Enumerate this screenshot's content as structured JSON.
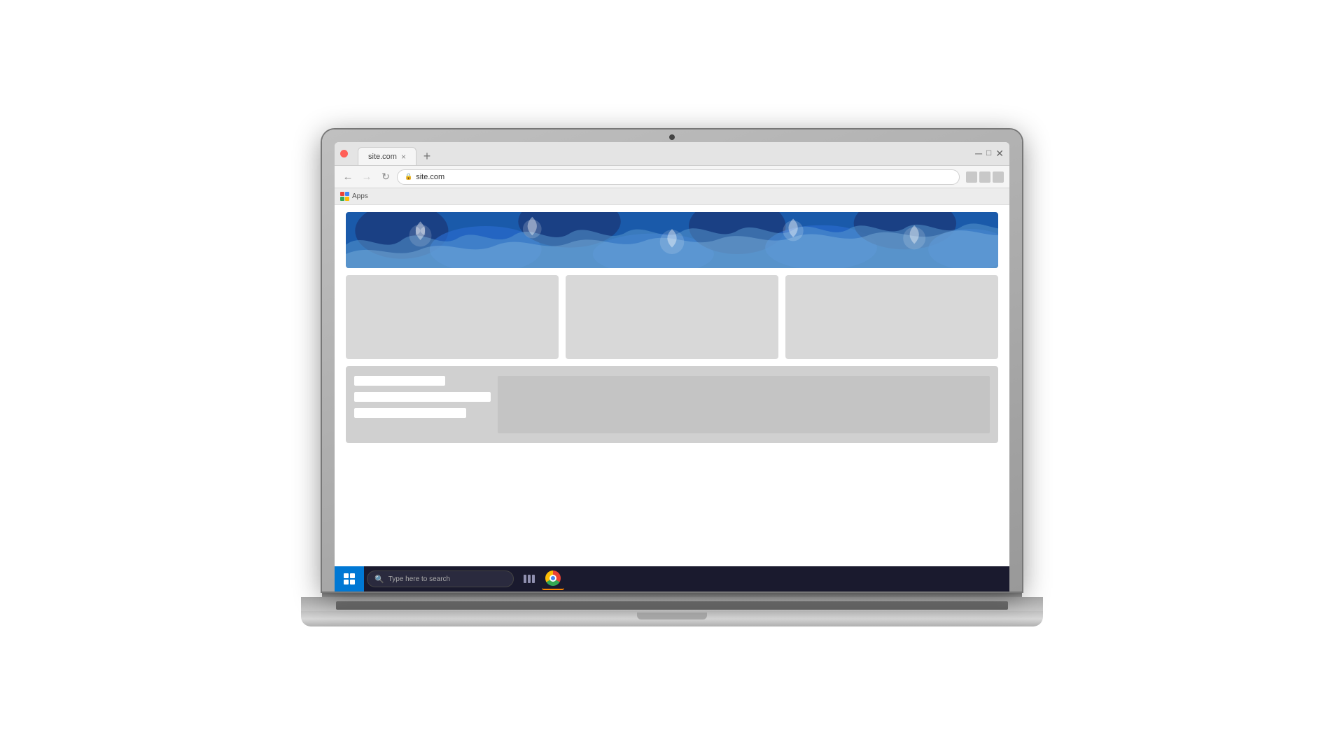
{
  "laptop": {
    "camera_label": "camera"
  },
  "browser": {
    "tab": {
      "label": "site.com",
      "close_label": "×",
      "new_tab_label": "+"
    },
    "nav": {
      "back_label": "←",
      "forward_label": "→",
      "refresh_label": "↻",
      "url": "site.com",
      "lock_icon": "🔒"
    },
    "bookmarks": {
      "apps_label": "Apps"
    },
    "toolbar_icons": [
      "icon1",
      "icon2",
      "icon3"
    ]
  },
  "webpage": {
    "hero": {
      "alt": "Decorative wave banner"
    },
    "cards": [
      {
        "id": "card-1"
      },
      {
        "id": "card-2"
      },
      {
        "id": "card-3"
      }
    ],
    "form": {
      "fields": [
        {
          "width": "short"
        },
        {
          "width": "medium"
        },
        {
          "width": "long"
        }
      ]
    }
  },
  "taskbar": {
    "start_label": "Start",
    "search_placeholder": "Type here to search",
    "apps": [
      {
        "name": "task-view",
        "label": "Task View"
      },
      {
        "name": "chrome",
        "label": "Google Chrome"
      }
    ]
  }
}
